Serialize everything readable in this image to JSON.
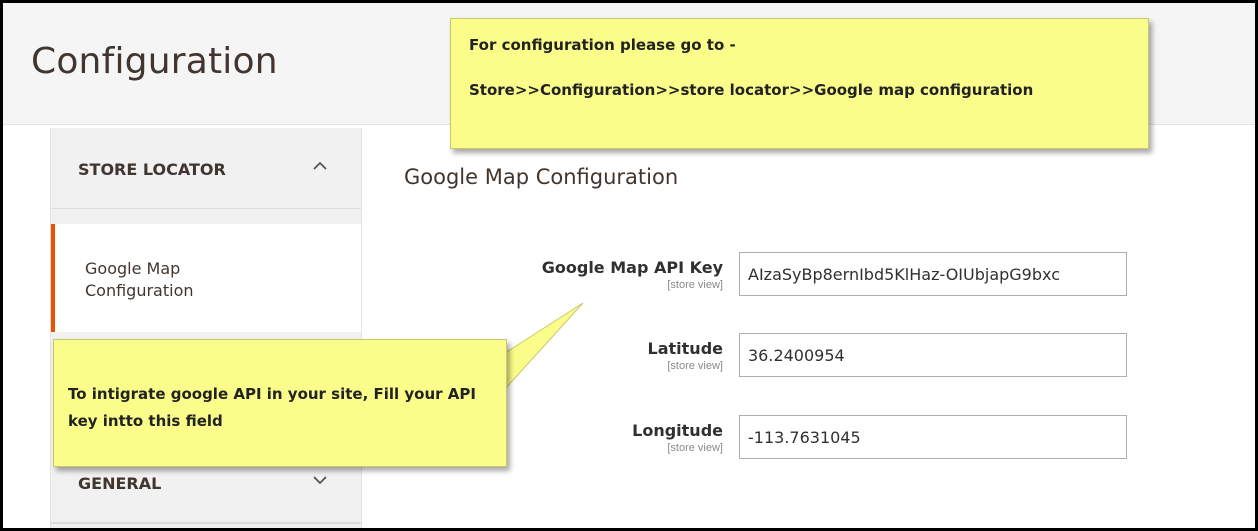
{
  "header": {
    "title": "Configuration"
  },
  "sidebar": {
    "sections": [
      {
        "label": "STORE LOCATOR",
        "chevron": "^"
      },
      {
        "label": "GENERAL",
        "chevron": "v"
      }
    ],
    "active_item": "Google Map Configuration"
  },
  "main": {
    "title": "Google Map Configuration",
    "fields": [
      {
        "label": "Google Map API Key",
        "scope": "[store view]",
        "value": "AIzaSyBp8ernIbd5KlHaz-OIUbjapG9bxc"
      },
      {
        "label": "Latitude",
        "scope": "[store view]",
        "value": "36.2400954"
      },
      {
        "label": "Longitude",
        "scope": "[store view]",
        "value": "-113.7631045"
      }
    ]
  },
  "notes": {
    "top_line1": "For configuration please go to -",
    "top_line2": "Store>>Configuration>>store locator>>Google map configuration",
    "left_text": "To intigrate google API in your site, Fill your API key intto this field"
  },
  "colors": {
    "note_bg": "#fafd89",
    "accent": "#eb5202",
    "header_bg": "#f5f5f5"
  }
}
